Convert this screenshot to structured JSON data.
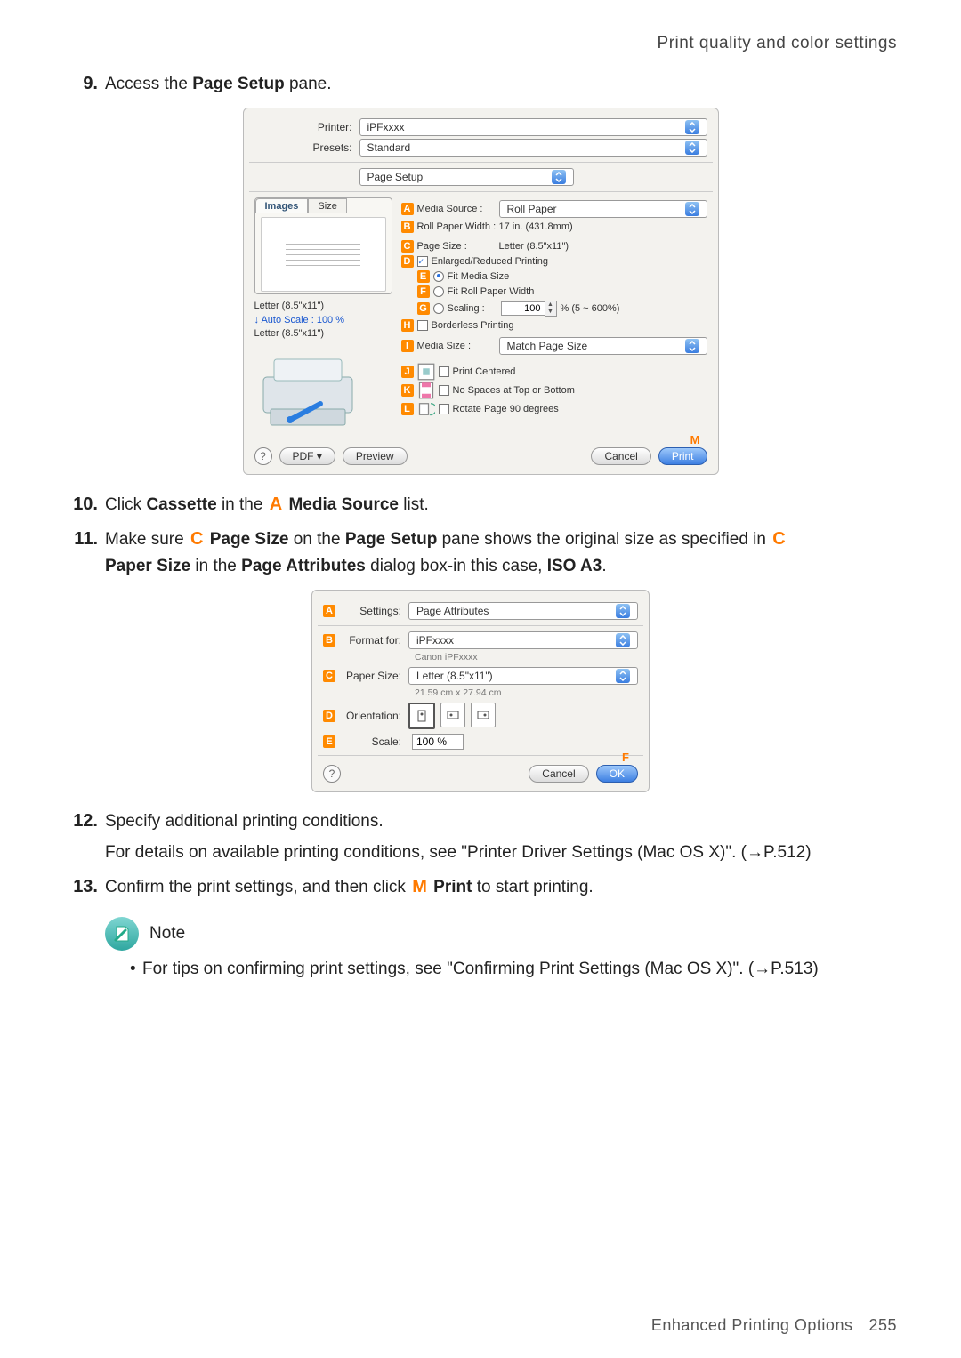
{
  "header": {
    "title": "Print quality and color settings"
  },
  "steps": {
    "s9": {
      "num": "9.",
      "text_a": "Access the ",
      "bold_b": "Page Setup",
      "text_c": " pane."
    },
    "s10": {
      "num": "10.",
      "parts": [
        "Click ",
        "Cassette",
        " in the ",
        "A",
        " ",
        "Media Source",
        " list."
      ]
    },
    "s11": {
      "num": "11.",
      "line1": [
        "Make sure ",
        "C",
        " ",
        "Page Size",
        " on the ",
        "Page Setup",
        " pane shows the original size as specified in ",
        "C"
      ],
      "line2": [
        "Paper Size",
        " in the ",
        "Page Attributes",
        " dialog box-in this case, ",
        "ISO A3",
        "."
      ]
    },
    "s12": {
      "num": "12.",
      "line1": "Specify additional printing conditions.",
      "line2": "For details on available printing conditions, see \"Printer Driver Settings (Mac OS X)\". (→P.512)"
    },
    "s13": {
      "num": "13.",
      "parts": [
        "Confirm the print settings, and then click ",
        "M",
        " ",
        "Print",
        " to start printing."
      ]
    }
  },
  "note": {
    "label": "Note",
    "bullet": "For tips on confirming print settings, see \"Confirming Print Settings (Mac OS X)\". (→P.513)"
  },
  "dialog1": {
    "printer_lbl": "Printer:",
    "printer_val": "iPFxxxx",
    "presets_lbl": "Presets:",
    "presets_val": "Standard",
    "pane_val": "Page Setup",
    "tab_images": "Images",
    "tab_size": "Size",
    "left_info1": "Letter (8.5\"x11\")",
    "left_info2": "Auto Scale : 100 %",
    "left_info3": "Letter (8.5\"x11\")",
    "A_label": "Media Source :",
    "A_val": "Roll Paper",
    "B_label": "Roll Paper Width :",
    "B_val": "17 in. (431.8mm)",
    "C_label": "Page Size :",
    "C_val": "Letter (8.5\"x11\")",
    "D_label": "Enlarged/Reduced Printing",
    "E_label": "Fit Media Size",
    "F_label": "Fit Roll Paper Width",
    "G_label": "Scaling :",
    "G_val": "100",
    "G_suffix": "% (5 ~ 600%)",
    "H_label": "Borderless Printing",
    "I_label": "Media Size :",
    "I_val": "Match Page Size",
    "J_label": "Print Centered",
    "K_label": "No Spaces at Top or Bottom",
    "L_label": "Rotate Page 90 degrees",
    "letters": {
      "A": "A",
      "B": "B",
      "C": "C",
      "D": "D",
      "E": "E",
      "F": "F",
      "G": "G",
      "H": "H",
      "I": "I",
      "J": "J",
      "K": "K",
      "L": "L",
      "M": "M"
    },
    "btn_pdf": "PDF ▾",
    "btn_preview": "Preview",
    "btn_cancel": "Cancel",
    "btn_print": "Print"
  },
  "dialog2": {
    "A_lbl": "Settings:",
    "A_val": "Page Attributes",
    "B_lbl": "Format for:",
    "B_val": "iPFxxxx",
    "B_sub": "Canon iPFxxxx",
    "C_lbl": "Paper Size:",
    "C_val": "Letter (8.5\"x11\")",
    "C_sub": "21.59 cm x 27.94 cm",
    "D_lbl": "Orientation:",
    "E_lbl": "Scale:",
    "E_val": "100 %",
    "letters": {
      "A": "A",
      "B": "B",
      "C": "C",
      "D": "D",
      "E": "E",
      "F": "F"
    },
    "btn_cancel": "Cancel",
    "btn_ok": "OK"
  },
  "footer": {
    "text": "Enhanced Printing Options",
    "page": "255"
  }
}
